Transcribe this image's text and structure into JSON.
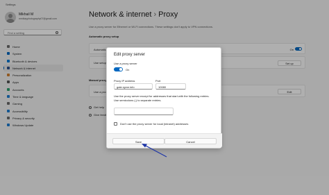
{
  "window": {
    "title": "Settings"
  },
  "user": {
    "name": "Mikhail M",
    "email": "mmikayphotography07@gmail.com"
  },
  "search": {
    "placeholder": "Find a setting"
  },
  "sidebar": {
    "items": [
      {
        "label": "Home",
        "icon": "home-icon",
        "color": "#6b6b6b",
        "active": false
      },
      {
        "label": "System",
        "icon": "system-icon",
        "color": "#0067c0",
        "active": false
      },
      {
        "label": "Bluetooth & devices",
        "icon": "bluetooth-icon",
        "color": "#0078d4",
        "active": false
      },
      {
        "label": "Network & internet",
        "icon": "network-icon",
        "color": "#2b4f8a",
        "active": true
      },
      {
        "label": "Personalization",
        "icon": "brush-icon",
        "color": "#d08030",
        "active": false
      },
      {
        "label": "Apps",
        "icon": "apps-icon",
        "color": "#555555",
        "active": false
      },
      {
        "label": "Accounts",
        "icon": "accounts-icon",
        "color": "#2f9e6e",
        "active": false
      },
      {
        "label": "Time & language",
        "icon": "globe-icon",
        "color": "#1e7bd0",
        "active": false
      },
      {
        "label": "Gaming",
        "icon": "gaming-icon",
        "color": "#6b6b6b",
        "active": false
      },
      {
        "label": "Accessibility",
        "icon": "accessibility-icon",
        "color": "#1e7bd0",
        "active": false
      },
      {
        "label": "Privacy & security",
        "icon": "shield-icon",
        "color": "#6b6b6b",
        "active": false
      },
      {
        "label": "Windows Update",
        "icon": "update-icon",
        "color": "#1e7bd0",
        "active": false
      }
    ]
  },
  "main": {
    "breadcrumb_parent": "Network & internet",
    "breadcrumb_sep": "›",
    "breadcrumb_current": "Proxy",
    "description": "Use a proxy server for Ethernet or Wi-Fi connections. These settings don't apply to VPN connections.",
    "auto_section": "Automatic proxy setup",
    "auto_row_label": "Automatically detect settings",
    "auto_row_state": "On",
    "script_row_label": "Use setup script",
    "setup_button": "Set up",
    "manual_section": "Manual proxy setup",
    "manual_row_label": "Use a proxy server",
    "edit_button": "Edit",
    "help_1": "Get help",
    "help_2": "Give feedback"
  },
  "dialog": {
    "title": "Edit proxy server",
    "use_proxy_label": "Use a proxy server",
    "toggle_state": "On",
    "ip_label": "Proxy IP address",
    "ip_value": "gate.rgrxe.info",
    "port_label": "Port",
    "port_value": "10080",
    "exceptions_text_1": "Use the proxy server except for addresses that start with the following entries.",
    "exceptions_text_2": "Use semicolons (;) to separate entries.",
    "exceptions_value": "",
    "checkbox_label": "Don't use the proxy server for local (intranet) addresses",
    "save_label": "Save",
    "cancel_label": "Cancel"
  },
  "colors": {
    "accent": "#0067c0",
    "annotation_arrow": "#1d35a8"
  }
}
